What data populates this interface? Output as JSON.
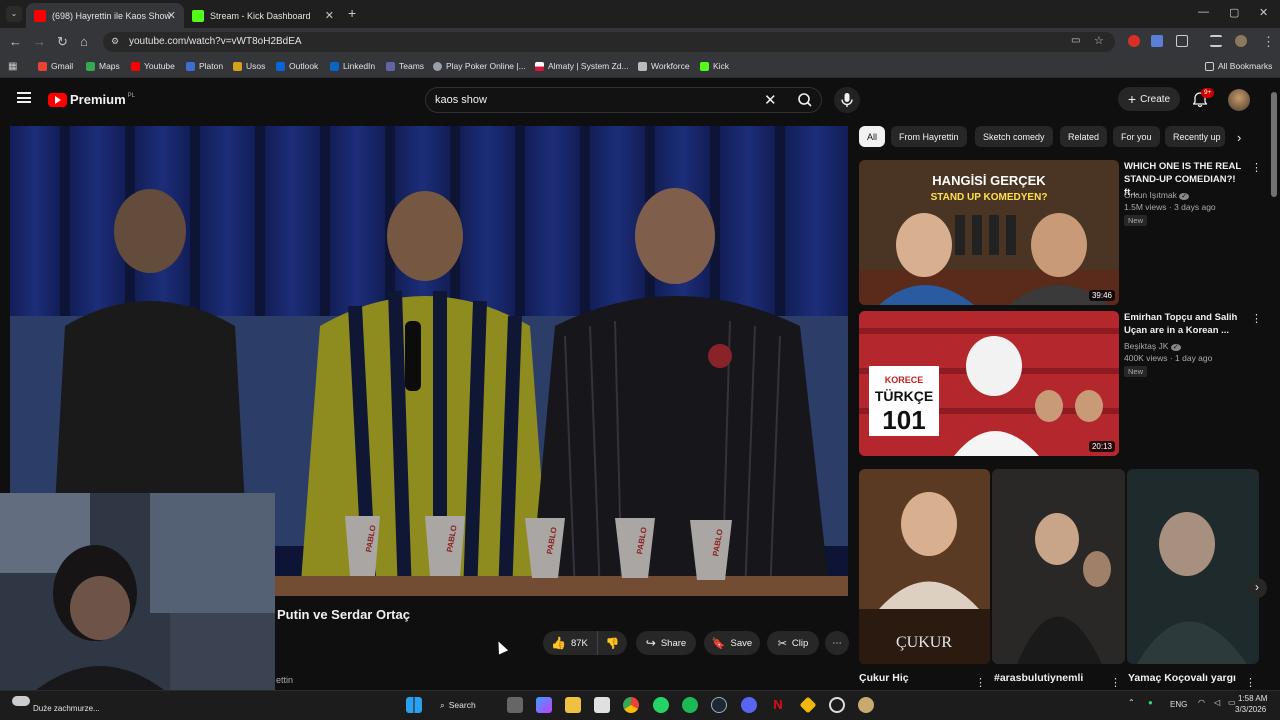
{
  "browser": {
    "tabs": [
      {
        "label": "(698) Hayrettin ile Kaos Show",
        "active": true
      },
      {
        "label": "Stream - Kick Dashboard",
        "active": false
      }
    ],
    "new_tab": "+",
    "url": "youtube.com/watch?v=vWT8oH2BdEA",
    "bookmarks": [
      "Gmail",
      "Maps",
      "Youtube",
      "Platon",
      "Usos",
      "Outlook",
      "LinkedIn",
      "Teams",
      "Play Poker Online |...",
      "Almaty | System Zd...",
      "Workforce",
      "Kick"
    ],
    "all_bookmarks": "All Bookmarks"
  },
  "youtube": {
    "logo": "Premium",
    "logo_region": "PL",
    "search_value": "kaos show",
    "create_label": "Create",
    "notifications_badge": "9+",
    "chips": [
      "All",
      "From Hayrettin",
      "Sketch comedy",
      "Related",
      "For you",
      "Recently up"
    ],
    "video": {
      "title": "Putin ve Serdar Ortaç",
      "likes": "87K",
      "share": "Share",
      "save": "Save",
      "clip": "Clip",
      "channel_fragment": "ettin",
      "cup_text": "PABLO"
    },
    "recommendations": [
      {
        "title": "WHICH ONE IS THE REAL STAND-UP COMEDIAN?! ft...",
        "channel": "Orkun Işıtmak",
        "meta": "1.5M views · 3 days ago",
        "badge": "New",
        "duration": "39:46",
        "thumb_text_1": "HANGİSİ GERÇEK",
        "thumb_text_2": "STAND UP KOMEDYEN?"
      },
      {
        "title": "Emirhan Topçu and Salih Uçan are in a Korean ...",
        "channel": "Beşiktaş JK",
        "meta": "400K views · 1 day ago",
        "badge": "New",
        "duration": "20:13",
        "thumb_text_1": "KORECE",
        "thumb_text_2": "TÜRKÇE",
        "thumb_text_3": "101"
      }
    ],
    "shorts": [
      {
        "title": "Çukur Hiç",
        "thumb_text": "ÇUKUR"
      },
      {
        "title": "#arasbulutiynemli"
      },
      {
        "title": "Yamaç Koçovalı yargı"
      }
    ]
  },
  "taskbar": {
    "search": "Search",
    "language": "ENG",
    "time": "1:58 AM",
    "date": "3/3/2026",
    "weather_text": "Duże zachmurze..."
  }
}
